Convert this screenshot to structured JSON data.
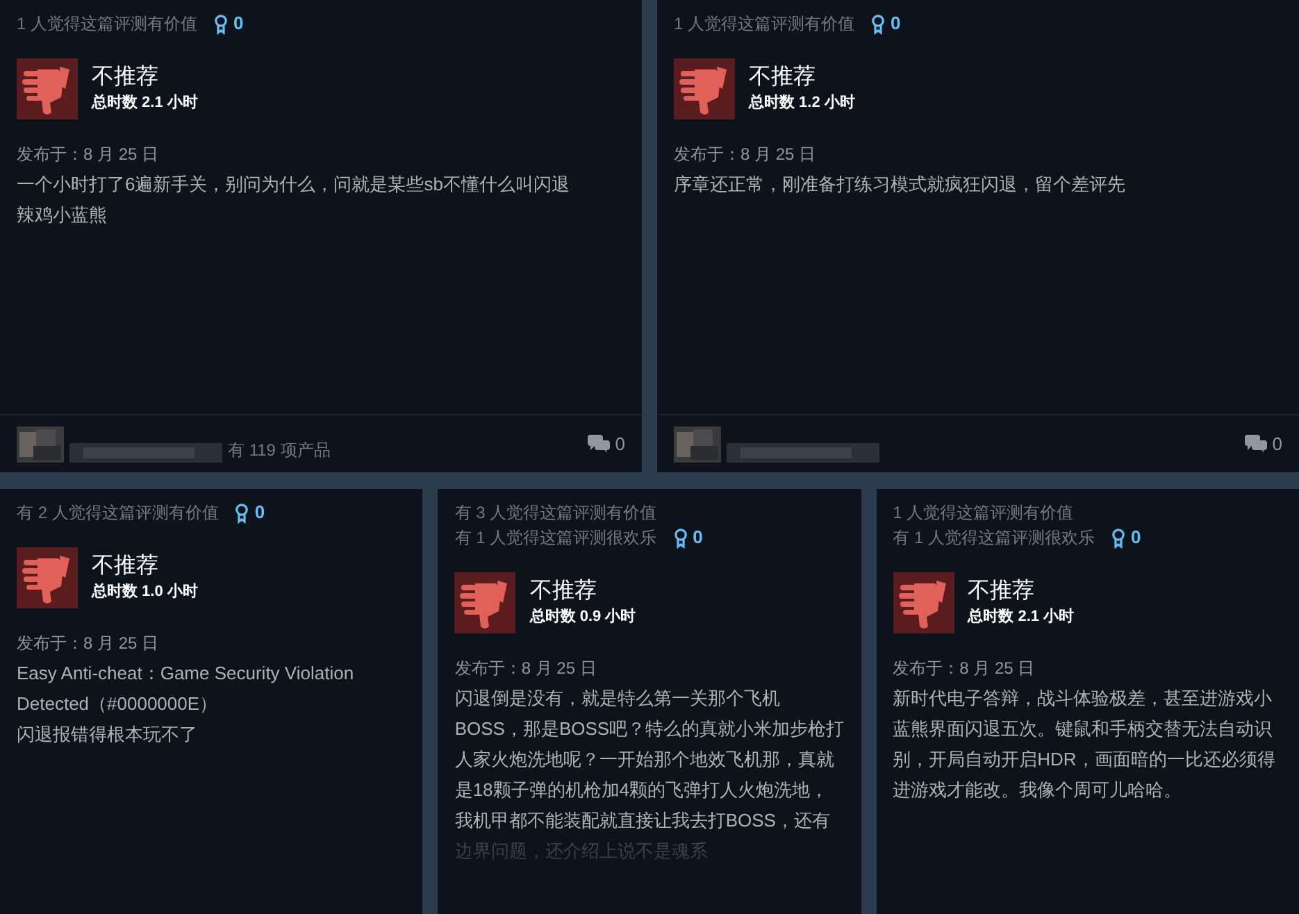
{
  "top_reviews": [
    {
      "helpful": [
        "1 人觉得这篇评测有价值"
      ],
      "awards": "0",
      "verdict": {
        "kind": "thumbs_down",
        "label": "不推荐"
      },
      "hours": "总时数 2.1 小时",
      "posted": "发布于：8 月 25 日",
      "body": [
        "一个小时打了6遍新手关，别问为什么，问就是某些sb不懂什么叫闪退",
        "辣鸡小蓝熊"
      ],
      "footer": {
        "products": "有 119 项产品",
        "comments": "0"
      }
    },
    {
      "helpful": [
        "1 人觉得这篇评测有价值"
      ],
      "awards": "0",
      "verdict": {
        "kind": "thumbs_down",
        "label": "不推荐"
      },
      "hours": "总时数 1.2 小时",
      "posted": "发布于：8 月 25 日",
      "body": [
        "序章还正常，刚准备打练习模式就疯狂闪退，留个差评先"
      ],
      "footer": {
        "comments": "0"
      }
    }
  ],
  "bottom_reviews": [
    {
      "helpful": [
        "有 2 人觉得这篇评测有价值"
      ],
      "awards": "0",
      "verdict": {
        "kind": "thumbs_down",
        "label": "不推荐"
      },
      "hours": "总时数 1.0 小时",
      "posted": "发布于：8 月 25 日",
      "body": [
        "Easy Anti-cheat：Game Security Violation Detected（#0000000E）",
        "闪退报错得根本玩不了"
      ]
    },
    {
      "helpful": [
        "有 3 人觉得这篇评测有价值",
        "有 1 人觉得这篇评测很欢乐"
      ],
      "awards": "0",
      "verdict": {
        "kind": "thumbs_down",
        "label": "不推荐"
      },
      "hours": "总时数 0.9 小时",
      "posted": "发布于：8 月 25 日",
      "body": [
        "闪退倒是没有，就是特么第一关那个飞机BOSS，那是BOSS吧？特么的真就小米加步枪打人家火炮洗地呢？一开始那个地效飞机那，真就是18颗子弹的机枪加4颗的飞弹打人火炮洗地，我机甲都不能装配就直接让我去打BOSS，还有边界问题，还介绍上说不是魂系"
      ],
      "faded": true
    },
    {
      "helpful": [
        "1 人觉得这篇评测有价值",
        "有 1 人觉得这篇评测很欢乐"
      ],
      "awards": "0",
      "verdict": {
        "kind": "thumbs_down",
        "label": "不推荐"
      },
      "hours": "总时数 2.1 小时",
      "posted": "发布于：8 月 25 日",
      "body": [
        "新时代电子答辩，战斗体验极差，甚至进游戏小蓝熊界面闪退五次。键鼠和手柄交替无法自动识别，开局自动开启HDR，画面暗的一比还必须得进游戏才能改。我像个周可儿哈哈。"
      ]
    }
  ]
}
